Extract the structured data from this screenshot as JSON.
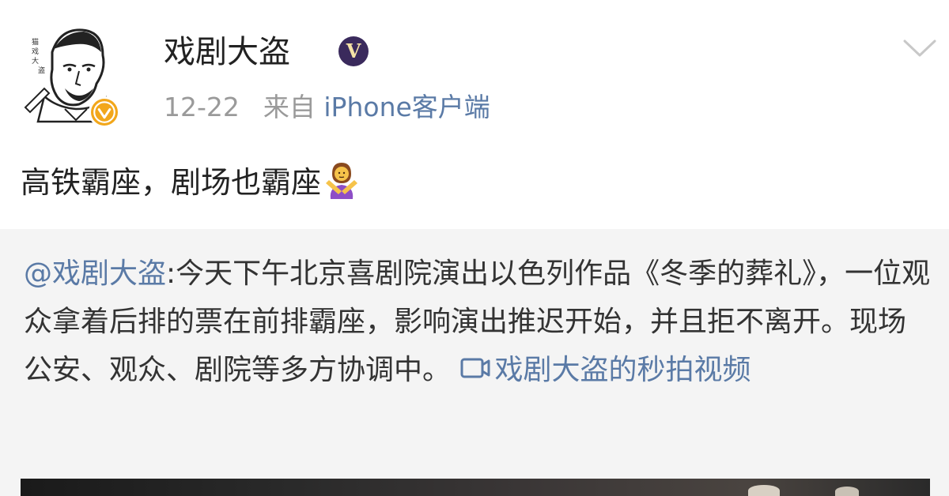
{
  "post": {
    "username": "戏剧大盗",
    "member_badge_glyph": "V",
    "date": "12-22",
    "source_prefix": "来自",
    "source_client": "iPhone客户端",
    "text": "高铁霸座，剧场也霸座"
  },
  "repost": {
    "mention": "@戏剧大盗",
    "body": ":今天下午北京喜剧院演出以色列作品《冬季的葬礼》，一位观众拿着后排的票在前排霸座，影响演出推迟开始，并且拒不离开。现场公安、观众、剧院等多方协调中。",
    "video_link": "戏剧大盗的秒拍视频"
  },
  "icons": {
    "avatar": "portrait-avatar",
    "verify": "verified-badge-icon",
    "member": "member-badge-icon",
    "menu": "chevron-down-icon",
    "emoji": "person-gesturing-no-emoji",
    "video": "video-icon"
  },
  "colors": {
    "link": "#5a7aa6",
    "verify_badge": "#f2a71b",
    "member_badge": "#3a2a5c",
    "repost_bg": "#f4f4f4"
  }
}
